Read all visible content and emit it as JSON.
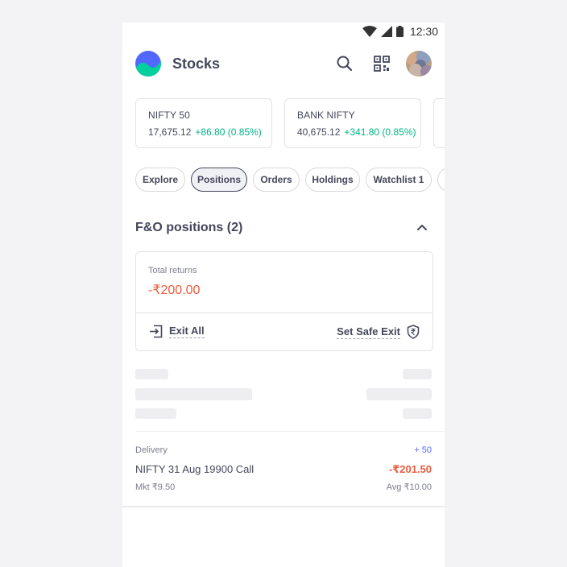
{
  "status_bar": {
    "time": "12:30"
  },
  "header": {
    "title": "Stocks"
  },
  "indices": [
    {
      "name": "NIFTY 50",
      "value": "17,675.12",
      "change": "+86.80 (0.85%)"
    },
    {
      "name": "BANK NIFTY",
      "value": "40,675.12",
      "change": "+341.80 (0.85%)"
    }
  ],
  "tabs": [
    {
      "label": "Explore"
    },
    {
      "label": "Positions",
      "active": true
    },
    {
      "label": "Orders"
    },
    {
      "label": "Holdings"
    },
    {
      "label": "Watchlist 1"
    }
  ],
  "fo_section": {
    "title": "F&O positions (2)",
    "returns_label": "Total returns",
    "returns_value": "-₹200.00",
    "exit_all_label": "Exit All",
    "safe_exit_label": "Set Safe Exit"
  },
  "position": {
    "type": "Delivery",
    "quantity": "+ 50",
    "name": "NIFTY 31 Aug 19900 Call",
    "pnl": "-₹201.50",
    "market_price": "Mkt ₹9.50",
    "avg_price": "Avg ₹10.00"
  },
  "colors": {
    "accent_green": "#00b386",
    "loss_red": "#eb5b3c",
    "quantity_blue": "#5367ff",
    "text_primary": "#44475b"
  },
  "icons": [
    "wifi-icon",
    "signal-icon",
    "battery-icon",
    "search-icon",
    "qr-code-icon",
    "chevron-up-icon",
    "exit-icon",
    "shield-rupee-icon"
  ]
}
